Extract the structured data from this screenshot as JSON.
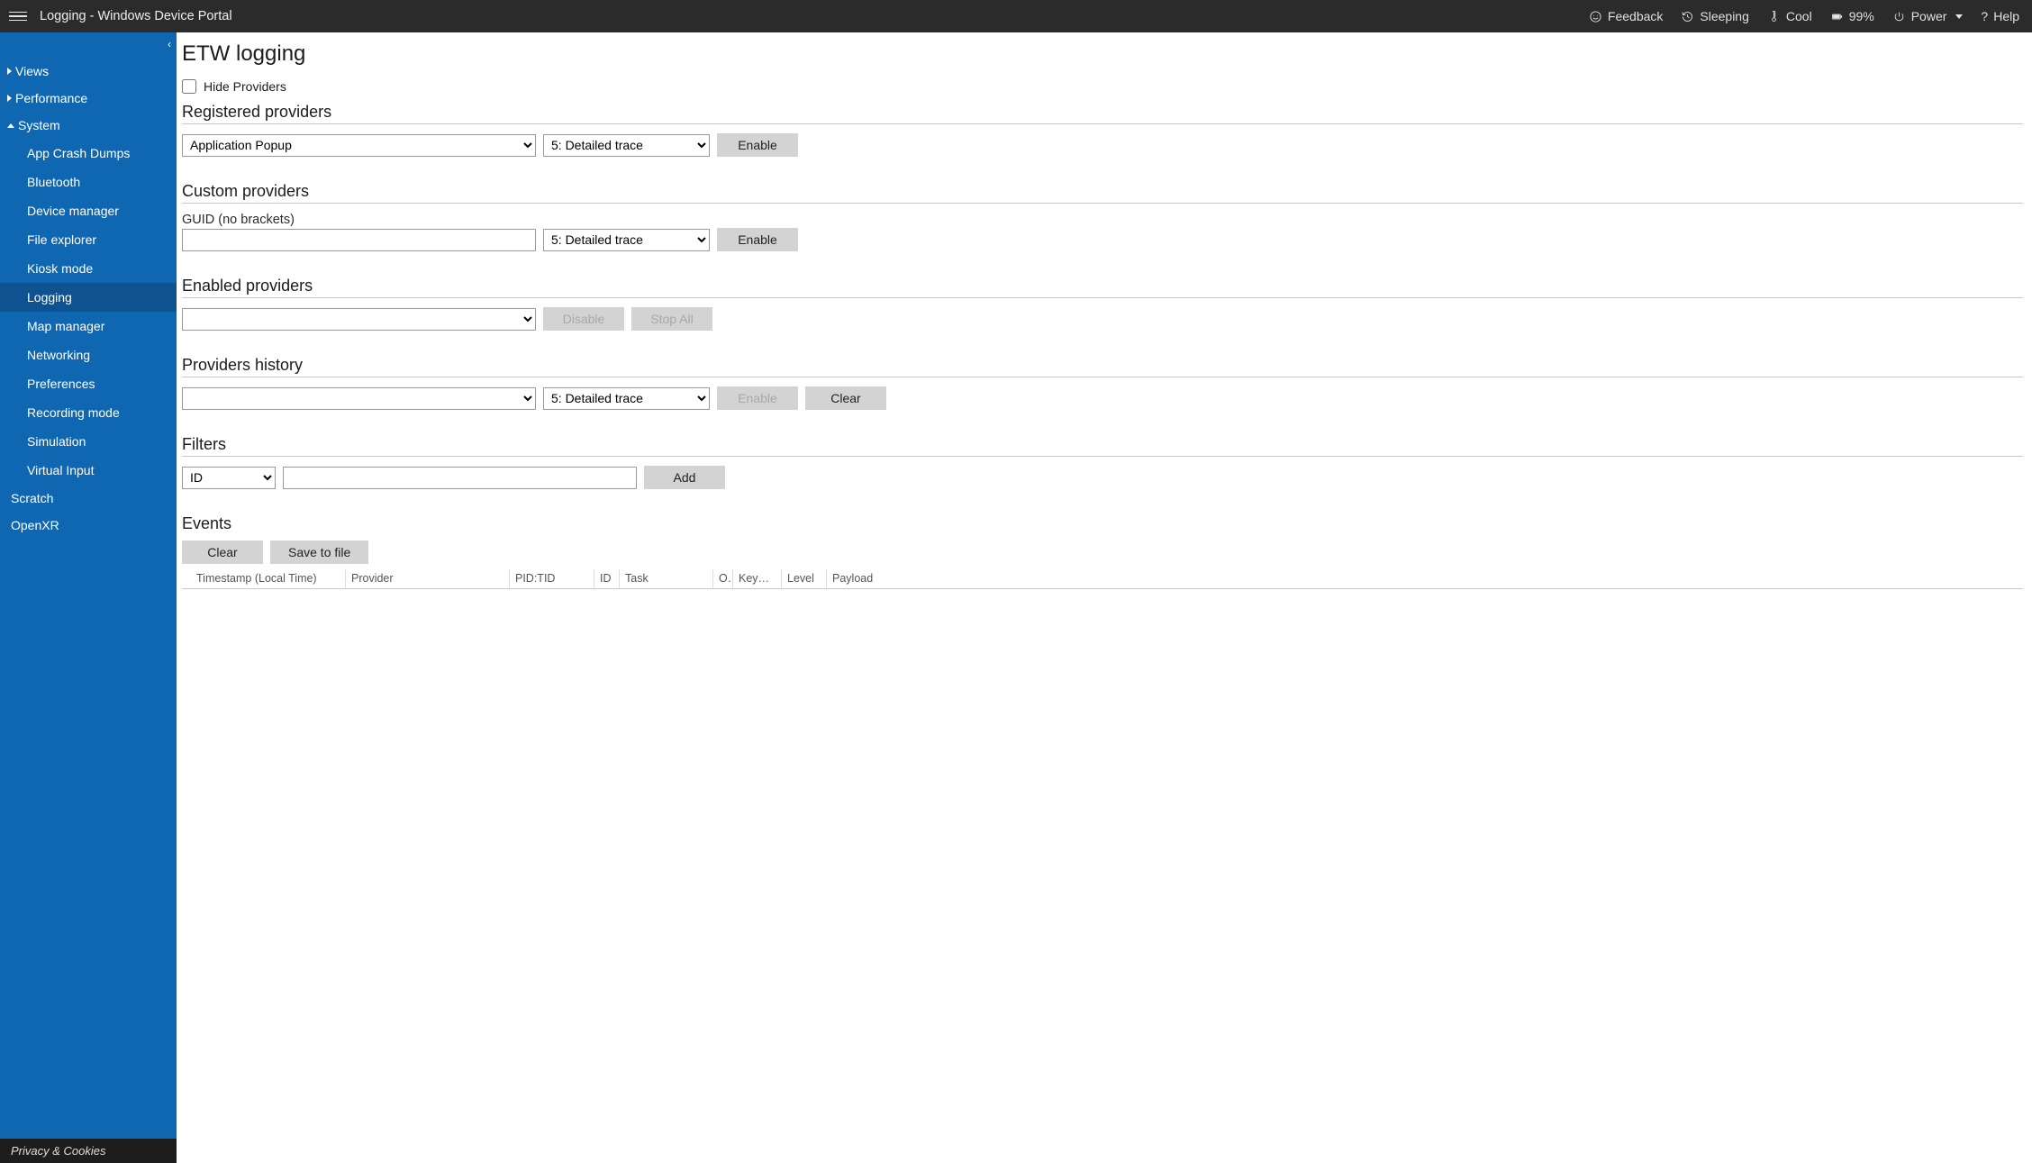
{
  "topbar": {
    "title": "Logging - Windows Device Portal",
    "feedback": "Feedback",
    "sleeping": "Sleeping",
    "cool": "Cool",
    "battery": "99%",
    "power": "Power",
    "help": "Help"
  },
  "sidebar": {
    "collapse_icon": "‹",
    "groups": [
      {
        "label": "Views",
        "expanded": false
      },
      {
        "label": "Performance",
        "expanded": false
      },
      {
        "label": "System",
        "expanded": true,
        "items": [
          "App Crash Dumps",
          "Bluetooth",
          "Device manager",
          "File explorer",
          "Kiosk mode",
          "Logging",
          "Map manager",
          "Networking",
          "Preferences",
          "Recording mode",
          "Simulation",
          "Virtual Input"
        ],
        "active_item": "Logging"
      }
    ],
    "top_items": [
      "Scratch",
      "OpenXR"
    ],
    "footer": "Privacy & Cookies"
  },
  "main": {
    "page_title": "ETW logging",
    "hide_providers_label": "Hide Providers",
    "registered": {
      "heading": "Registered providers",
      "provider_selected": "Application Popup",
      "level_selected": "5: Detailed trace",
      "enable": "Enable"
    },
    "custom": {
      "heading": "Custom providers",
      "guid_label": "GUID (no brackets)",
      "guid_value": "",
      "level_selected": "5: Detailed trace",
      "enable": "Enable"
    },
    "enabled": {
      "heading": "Enabled providers",
      "selected": "",
      "disable": "Disable",
      "stop_all": "Stop All"
    },
    "history": {
      "heading": "Providers history",
      "selected": "",
      "level_selected": "5: Detailed trace",
      "enable": "Enable",
      "clear": "Clear"
    },
    "filters": {
      "heading": "Filters",
      "field_selected": "ID",
      "value": "",
      "add": "Add"
    },
    "events": {
      "heading": "Events",
      "clear": "Clear",
      "save": "Save to file",
      "columns": [
        "Timestamp (Local Time)",
        "Provider",
        "PID:TID",
        "ID",
        "Task",
        "O...",
        "Keyword",
        "Level",
        "Payload"
      ]
    }
  },
  "trace_levels": [
    "5: Detailed trace"
  ]
}
